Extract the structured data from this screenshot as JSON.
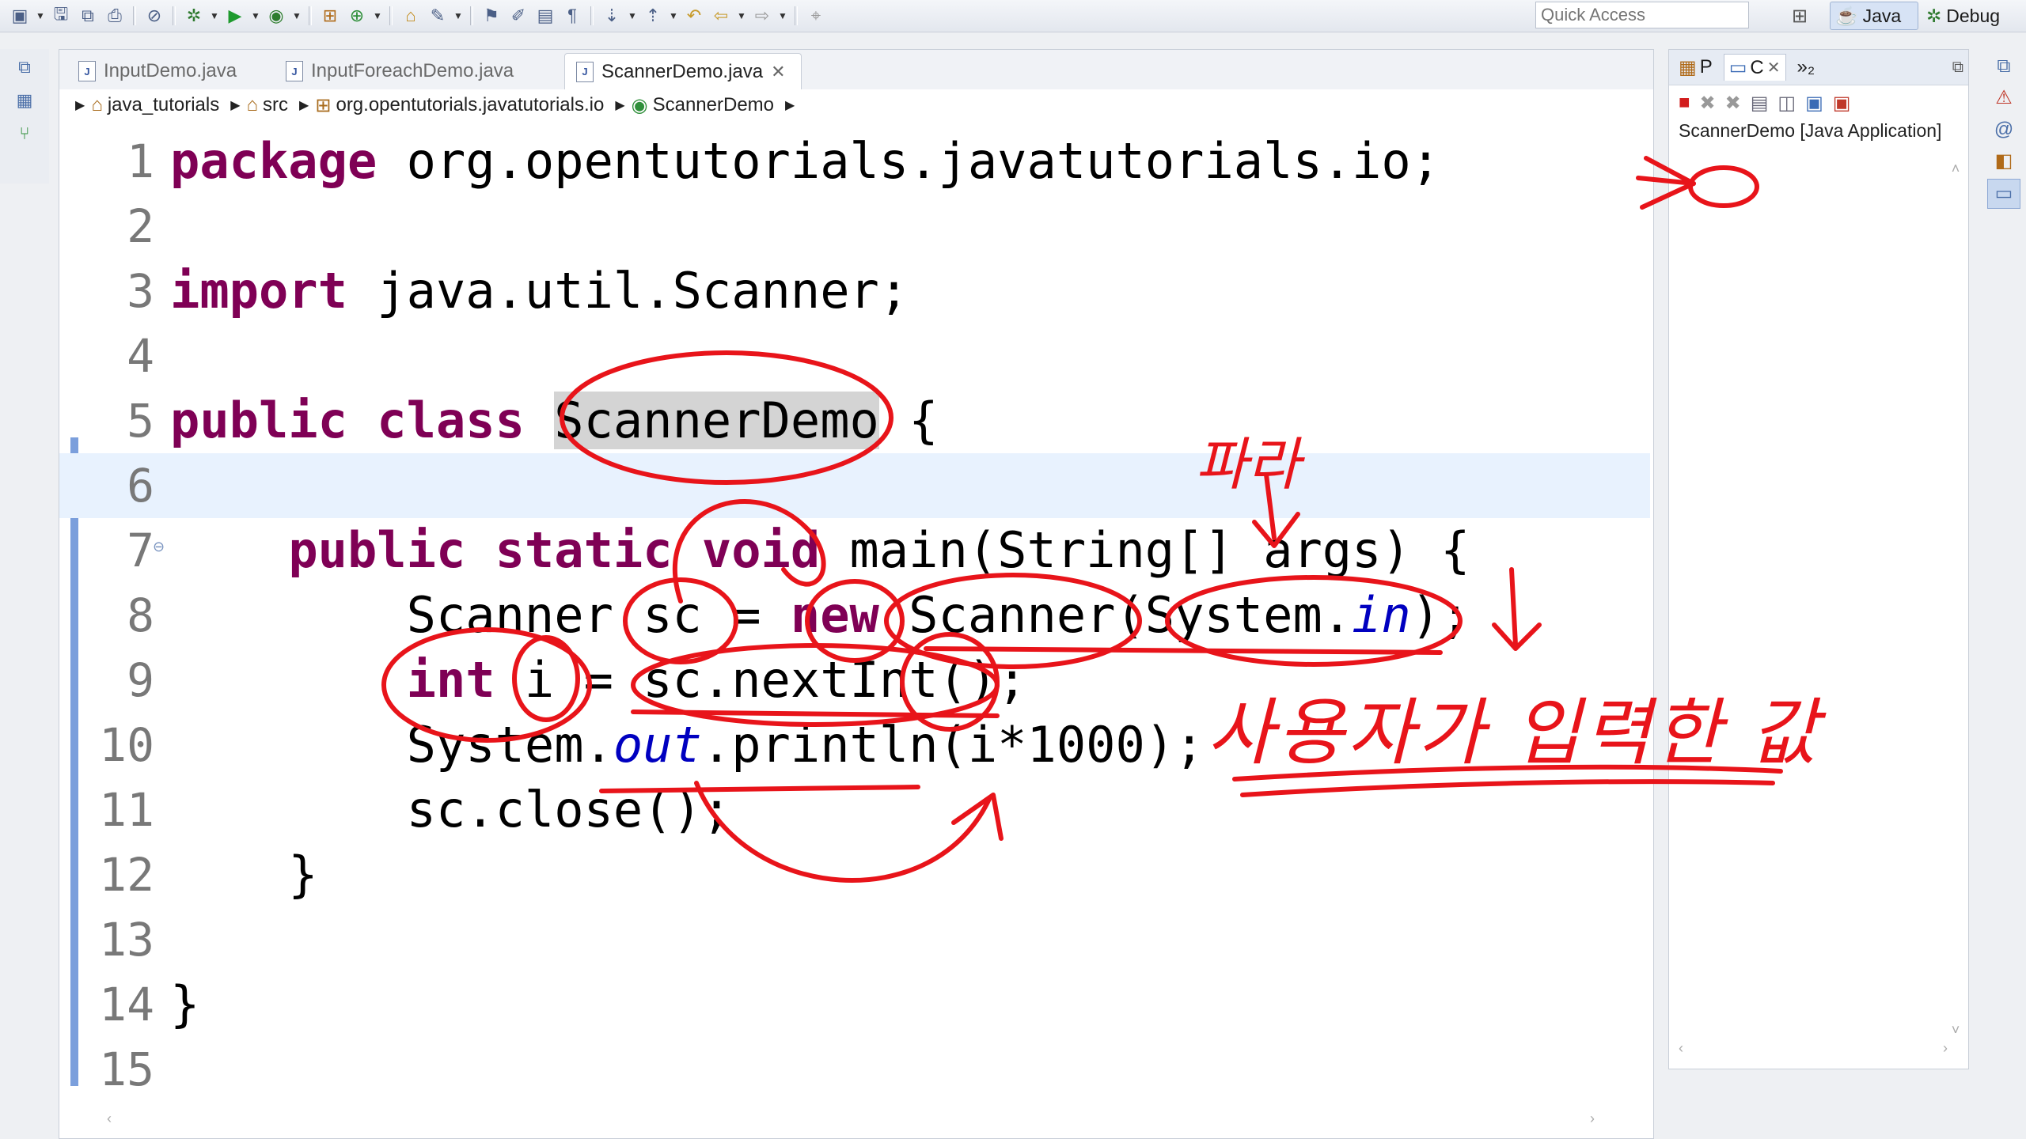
{
  "toolbar": {
    "quick_access_placeholder": "Quick Access",
    "perspective_java": "Java",
    "perspective_debug": "Debug"
  },
  "editor": {
    "tabs": [
      {
        "label": "InputDemo.java",
        "active": false
      },
      {
        "label": "InputForeachDemo.java",
        "active": false
      },
      {
        "label": "ScannerDemo.java",
        "active": true
      }
    ],
    "breadcrumb": [
      "java_tutorials",
      "src",
      "org.opentutorials.javatutorials.io",
      "ScannerDemo"
    ],
    "line_numbers": [
      "1",
      "2",
      "3",
      "4",
      "5",
      "6",
      "7",
      "8",
      "9",
      "10",
      "11",
      "12",
      "13",
      "14",
      "15"
    ],
    "code": {
      "l1_kw": "package",
      "l1_rest": " org.opentutorials.javatutorials.io;",
      "l3_kw": "import",
      "l3_rest": " java.util.Scanner;",
      "l5_kw": "public class",
      "l5_sel": "ScannerDemo",
      "l5_rest": " {",
      "l7_indent": "    ",
      "l7_kw": "public static void",
      "l7_rest": " main(String[] args) {",
      "l8_a": "        Scanner sc = ",
      "l8_kw": "new",
      "l8_b": " Scanner(System.",
      "l8_fld": "in",
      "l8_c": ");",
      "l9_indent": "        ",
      "l9_kw": "int",
      "l9_rest": " i = sc.nextInt();",
      "l10_a": "        System.",
      "l10_fld": "out",
      "l10_b": ".println(i*1000);",
      "l11": "        sc.close();",
      "l12": "    }",
      "l14": "}"
    }
  },
  "console": {
    "tab_p": "P",
    "tab_c": "C",
    "overflow": "»₂",
    "title": "ScannerDemo [Java Application]"
  },
  "annotations": {
    "handwritten_param": "파라",
    "handwritten_input": "사용자가 입력한 값"
  },
  "colors": {
    "keyword": "#7f0055",
    "field": "#0000c0",
    "annotation": "#e8141a",
    "highlight_line": "#e8f2fe"
  }
}
